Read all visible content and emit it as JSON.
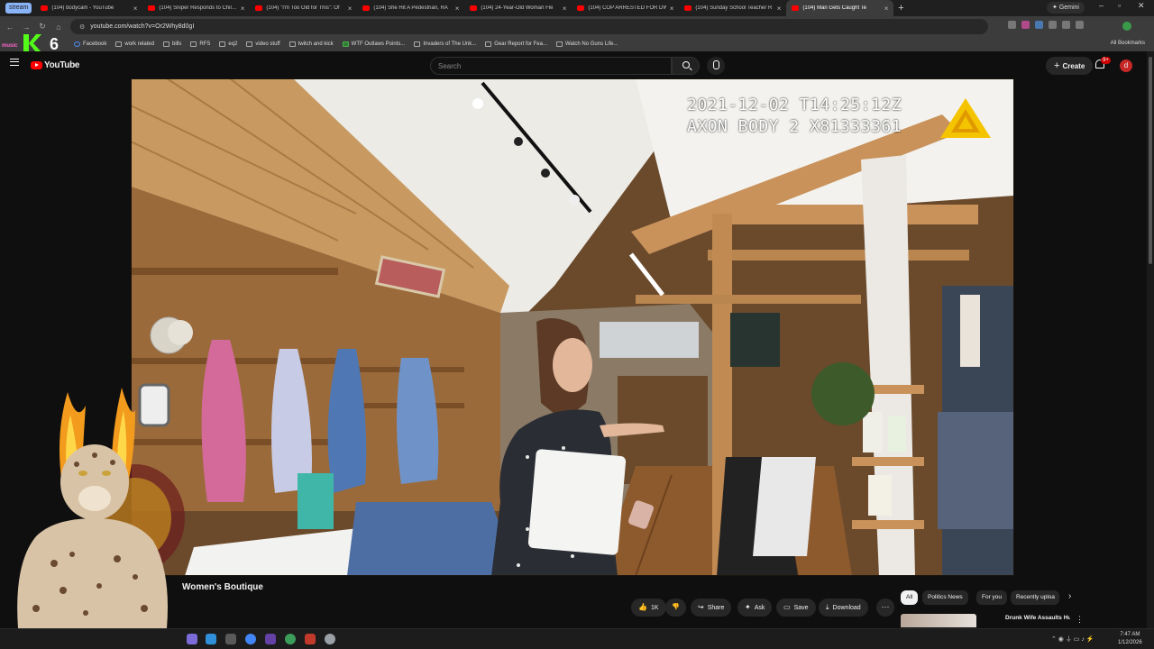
{
  "browser": {
    "tab_group_label": "stream",
    "tabs": [
      {
        "title": "(104) bodycam - YouTube",
        "active": false
      },
      {
        "title": "(104) Sniper Responds to Chil…",
        "active": false
      },
      {
        "title": "(104) \"I'm Too Old for This\": Of",
        "active": false
      },
      {
        "title": "(104) She Hit A Pedestrian, RA",
        "active": false
      },
      {
        "title": "(104) 24-Year-Old Woman Fle",
        "active": false
      },
      {
        "title": "(104) COP ARRESTED FOR DWI A",
        "active": false
      },
      {
        "title": "(104) Sunday School Teacher R",
        "active": false
      },
      {
        "title": "(104) Man Gets Caught Te",
        "active": true
      }
    ],
    "gemini_label": "Gemini",
    "url": "youtube.com/watch?v=Or2Why8d0gI",
    "bookmarks": [
      "Facebook",
      "work related",
      "bills",
      "RFS",
      "eq2",
      "video stuff",
      "twitch and kick",
      "WTF Outlaws Points...",
      "Invaders of The Unk...",
      "Gear Report for Fea...",
      "Watch No Guns Life..."
    ],
    "all_bookmarks_label": "All Bookmarks",
    "stream_logo_text": "music",
    "stream_logo_number": "6"
  },
  "youtube": {
    "logo_text": "YouTube",
    "search_placeholder": "Search",
    "create_label": "Create",
    "notification_count": "9+",
    "avatar_letter": "d"
  },
  "video": {
    "overlay_timestamp": "2021-12-02 T14:25:12Z",
    "overlay_device": "AXON BODY 2 X81333361",
    "title_visible": "Women's Boutique",
    "likes": "1K",
    "actions": {
      "share": "Share",
      "ask": "Ask",
      "save": "Save",
      "download": "Download"
    }
  },
  "recommendations": {
    "chips": [
      "All",
      "Politics News",
      "For you",
      "Recently uploa"
    ],
    "first_title": "Drunk Wife Assaults Husband and Holds Him Against His Wil"
  },
  "taskbar": {
    "clock_time": "7:47 AM",
    "clock_date": "1/12/2026"
  },
  "colors": {
    "youtube_red": "#ff0000",
    "page_bg": "#0f0f0f",
    "axon_yellow": "#f5c400"
  }
}
